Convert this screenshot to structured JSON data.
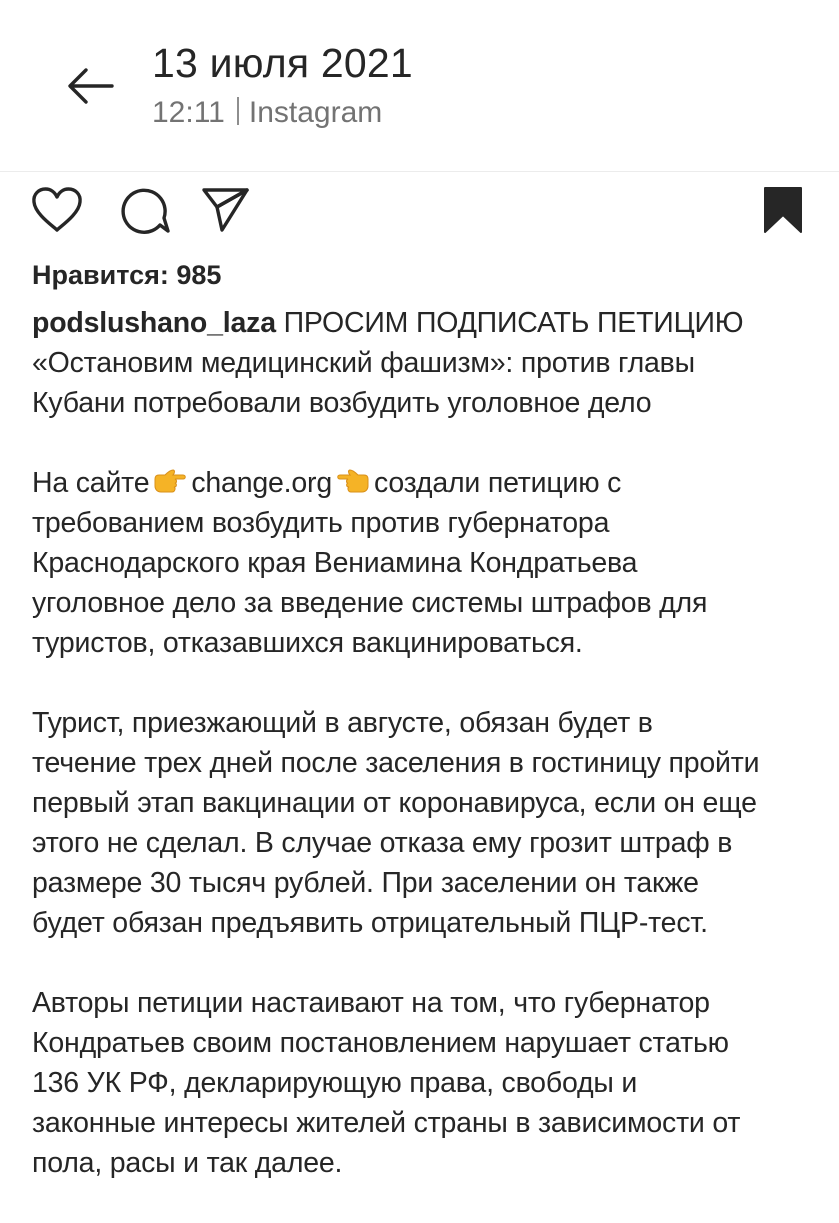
{
  "header": {
    "title": "13 июля 2021",
    "time": "12:11",
    "source": "Instagram",
    "back_icon": "arrow-left-icon"
  },
  "actions": {
    "icons": [
      "heart-icon",
      "comment-icon",
      "share-icon",
      "bookmark-icon"
    ]
  },
  "likes": "Нравится: 985",
  "post": {
    "username": "podslushano_laza",
    "paragraphs": [
      {
        "lines": [
          " ПРОСИМ ПОДПИСАТЬ ПЕТИЦИЮ",
          "«Остановим медицинский фашизм»: против главы",
          "Кубани потребовали возбудить уголовное дело"
        ]
      },
      {
        "first_line": {
          "before": "На сайте",
          "emoji_left": "point-right-emoji",
          "link": "change.org",
          "emoji_right": "point-left-emoji",
          "after": "создали петицию с"
        },
        "lines": [
          "требованием возбудить против губернатора",
          "Краснодарского края Вениамина Кондратьева",
          "уголовное дело за введение системы штрафов для",
          "туристов, отказавшихся вакцинироваться."
        ]
      },
      {
        "lines": [
          "Турист, приезжающий в августе, обязан будет в",
          "течение трех дней после заселения в гостиницу пройти",
          "первый этап вакцинации от коронавируса, если он еще",
          "этого не сделал. В случае отказа ему грозит штраф в",
          "размере 30 тысяч рублей. При заселении он также",
          "будет обязан предъявить отрицательный ПЦР-тест."
        ]
      },
      {
        "lines": [
          "Авторы петиции настаивают на том, что губернатор",
          "Кондратьев своим постановлением нарушает статью",
          "136 УК РФ, декларирующую права, свободы и",
          "законные интересы жителей страны в зависимости от",
          "пола, расы и так далее."
        ]
      }
    ]
  },
  "colors": {
    "text": "#262626",
    "secondary": "#737373",
    "divider": "#ececec",
    "emoji": "#f5b326"
  }
}
